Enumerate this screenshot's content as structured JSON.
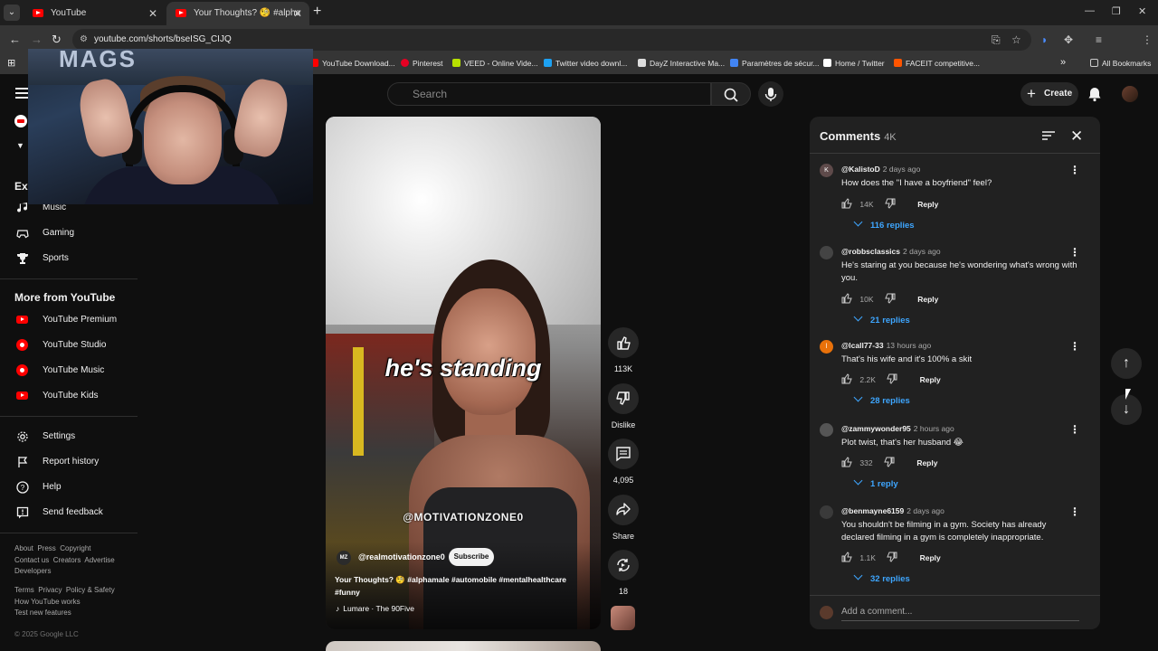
{
  "browser": {
    "tabs": [
      {
        "label": "YouTube"
      },
      {
        "label": "Your Thoughts? 🧐 #alpha"
      }
    ],
    "url": "youtube.com/shorts/bseISG_CIJQ",
    "bookmarks": [
      {
        "label": "YouTube Download...",
        "color": "#ff0000"
      },
      {
        "label": "Pinterest",
        "color": "#e60023"
      },
      {
        "label": "VEED - Online Vide...",
        "color": "#b7e000"
      },
      {
        "label": "Twitter video downl...",
        "color": "#1da1f2"
      },
      {
        "label": "DayZ Interactive Ma...",
        "color": "#dddddd"
      },
      {
        "label": "Paramètres de sécur...",
        "color": "#4285f4"
      },
      {
        "label": "Home / Twitter",
        "color": "#ffffff"
      },
      {
        "label": "FACEIT competitive...",
        "color": "#ff5500"
      }
    ],
    "all_bookmarks": "All Bookmarks"
  },
  "header": {
    "search_placeholder": "Search",
    "create_label": "Create"
  },
  "webcam": {
    "backdrop_text": "MAGS"
  },
  "sidebar": {
    "explore_label": "Exp",
    "explore_items": [
      {
        "label": "Music",
        "icon": "music-icon"
      },
      {
        "label": "Gaming",
        "icon": "gaming-icon"
      },
      {
        "label": "Sports",
        "icon": "trophy-icon"
      }
    ],
    "more_title": "More from YouTube",
    "more_items": [
      {
        "label": "YouTube Premium"
      },
      {
        "label": "YouTube Studio"
      },
      {
        "label": "YouTube Music"
      },
      {
        "label": "YouTube Kids"
      }
    ],
    "settings_items": [
      {
        "label": "Settings"
      },
      {
        "label": "Report history"
      },
      {
        "label": "Help"
      },
      {
        "label": "Send feedback"
      }
    ],
    "footer1": "About  Press  Copyright\nContact us  Creators  Advertise\nDevelopers",
    "footer2": "Terms  Privacy  Policy & Safety\nHow YouTube works\nTest new features",
    "copyright": "© 2025 Google LLC"
  },
  "short": {
    "caption": "he's standing",
    "watermark": "@MOTIVATIONZONE0",
    "channel_initials": "MZ",
    "channel": "@realmotivationzone0",
    "subscribe": "Subscribe",
    "title": "Your Thoughts? 🧐 #alphamale #automobile #mentalhealthcare #funny",
    "music": "Lumare · The 90Five"
  },
  "actions": {
    "likes": "113K",
    "dislike": "Dislike",
    "comments": "4,095",
    "share": "Share",
    "remix": "18"
  },
  "comments": {
    "title": "Comments",
    "count": "4K",
    "add_placeholder": "Add a comment...",
    "items": [
      {
        "handle": "@KalistoD",
        "time": "2 days ago",
        "text": "How does the \"I have a boyfriend\" feel?",
        "likes": "14K",
        "replies": "116 replies",
        "avatar_letter": "K",
        "avatar_color": "#5e4a4a"
      },
      {
        "handle": "@robbsclassics",
        "time": "2 days ago",
        "text": "He's staring at you because he's wondering what's wrong with you.",
        "likes": "10K",
        "replies": "21 replies",
        "avatar_letter": "",
        "avatar_color": "#444444"
      },
      {
        "handle": "@lcall77-33",
        "time": "13 hours ago",
        "text": "That's his wife and it's 100% a skit",
        "likes": "2.2K",
        "replies": "28 replies",
        "avatar_letter": "l",
        "avatar_color": "#e8710a"
      },
      {
        "handle": "@zammywonder95",
        "time": "2 hours ago",
        "text": "Plot twist, that's her husband 😂",
        "likes": "332",
        "replies": "1 reply",
        "avatar_letter": "",
        "avatar_color": "#555555"
      },
      {
        "handle": "@benmayne6159",
        "time": "2 days ago",
        "text": "You shouldn't be filming in a gym. Society has already declared filming in a gym is completely inappropriate.",
        "likes": "1.1K",
        "replies": "32 replies",
        "avatar_letter": "",
        "avatar_color": "#3a3a3a"
      }
    ],
    "reply_label": "Reply"
  }
}
